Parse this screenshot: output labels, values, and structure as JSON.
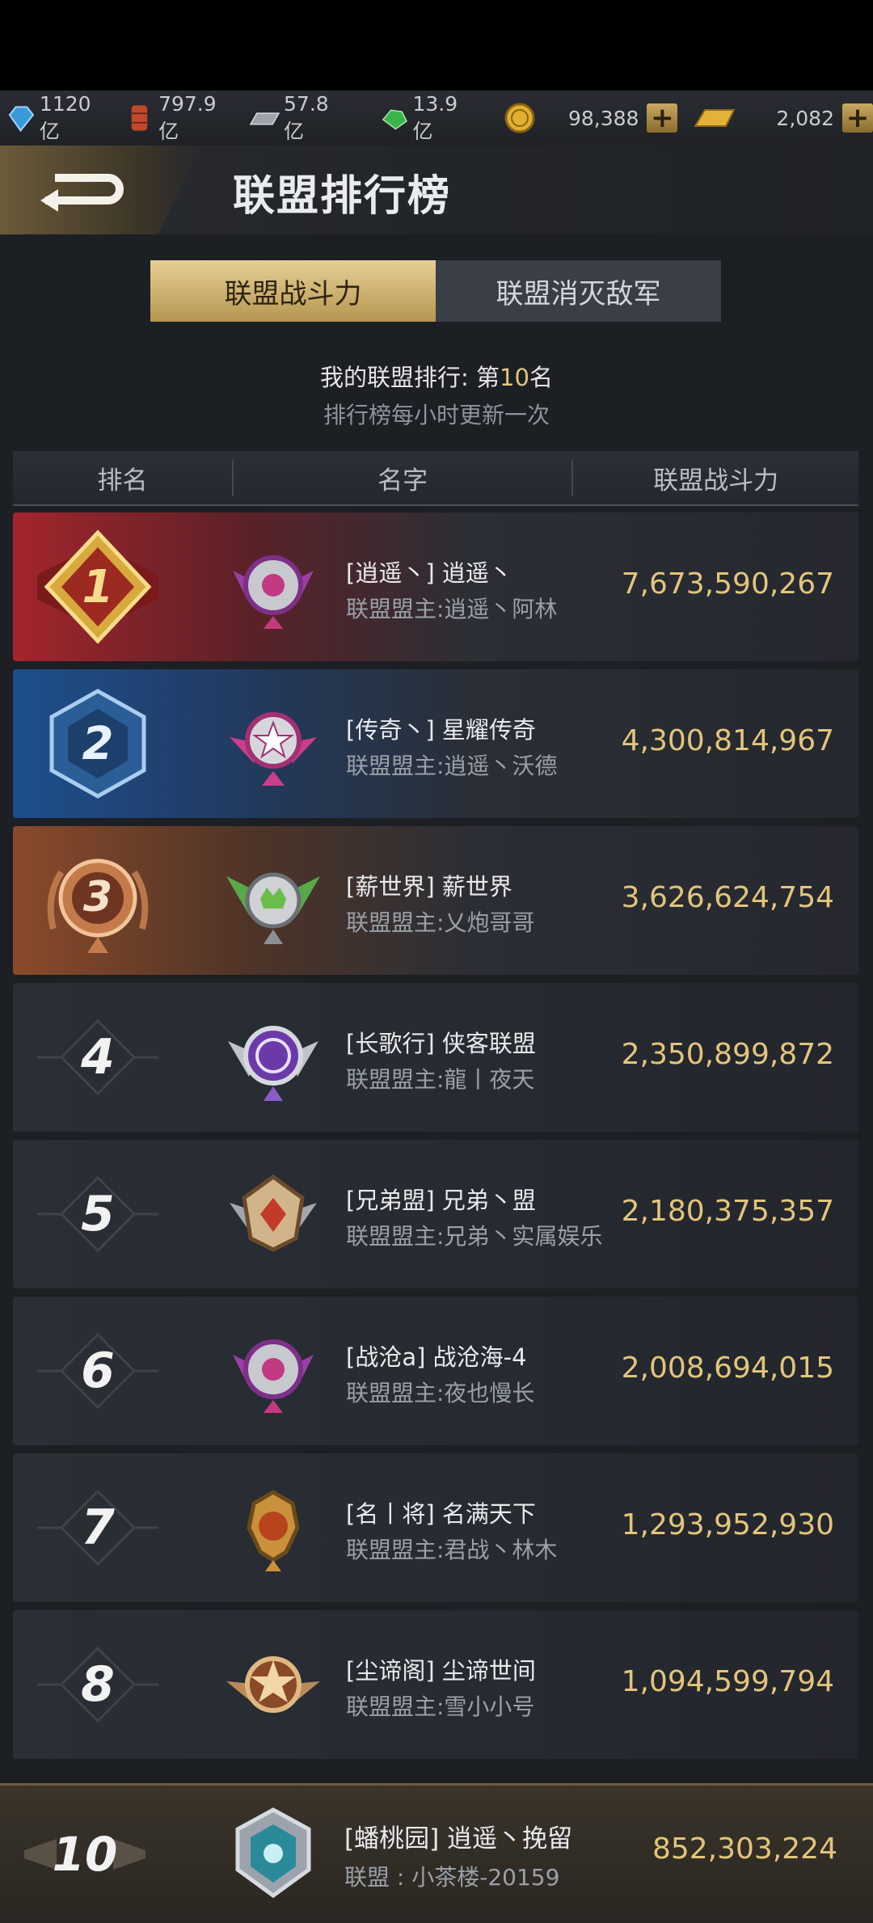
{
  "resources": [
    {
      "name": "blue-crystal",
      "value": "1120亿",
      "color": "#3a9ad9"
    },
    {
      "name": "oil-barrel",
      "value": "797.9亿",
      "color": "#c0492b"
    },
    {
      "name": "steel",
      "value": "57.8亿",
      "color": "#9ea3aa"
    },
    {
      "name": "green-ore",
      "value": "13.9亿",
      "color": "#3bb34a"
    },
    {
      "name": "gold-coin",
      "value": "98,388",
      "color": "#e0b030"
    },
    {
      "name": "gold-bar",
      "value": "2,082",
      "color": "#e3b23a"
    }
  ],
  "header": {
    "title": "联盟排行榜"
  },
  "tabs": [
    {
      "label": "联盟战斗力",
      "active": true
    },
    {
      "label": "联盟消灭敌军",
      "active": false
    }
  ],
  "my_rank": {
    "prefix": "我的联盟排行: 第",
    "number": "10",
    "suffix": "名",
    "update_note": "排行榜每小时更新一次"
  },
  "columns": [
    "排名",
    "名字",
    "联盟战斗力"
  ],
  "rows": [
    {
      "rank": "1",
      "name": "[逍遥丶] 逍遥丶",
      "leader": "联盟盟主:逍遥丶阿林",
      "power": "7,673,590,267"
    },
    {
      "rank": "2",
      "name": "[传奇丶] 星耀传奇",
      "leader": "联盟盟主:逍遥丶沃德",
      "power": "4,300,814,967"
    },
    {
      "rank": "3",
      "name": "[薪世界] 薪世界",
      "leader": "联盟盟主:乂炮哥哥",
      "power": "3,626,624,754"
    },
    {
      "rank": "4",
      "name": "[长歌行] 侠客联盟",
      "leader": "联盟盟主:龍丨夜天",
      "power": "2,350,899,872"
    },
    {
      "rank": "5",
      "name": "[兄弟盟] 兄弟丶盟",
      "leader": "联盟盟主:兄弟丶实属娱乐",
      "power": "2,180,375,357"
    },
    {
      "rank": "6",
      "name": "[战沧a] 战沧海-4",
      "leader": "联盟盟主:夜也慢长",
      "power": "2,008,694,015"
    },
    {
      "rank": "7",
      "name": "[名丨将] 名满天下",
      "leader": "联盟盟主:君战丶林木",
      "power": "1,293,952,930"
    },
    {
      "rank": "8",
      "name": "[尘谛阁] 尘谛世间",
      "leader": "联盟盟主:雪小小号",
      "power": "1,094,599,794"
    }
  ],
  "my_alliance": {
    "rank": "10",
    "name": "[蟠桃园] 逍遥丶挽留",
    "leader": "联盟 : 小茶楼-20159",
    "power": "852,303,224"
  }
}
